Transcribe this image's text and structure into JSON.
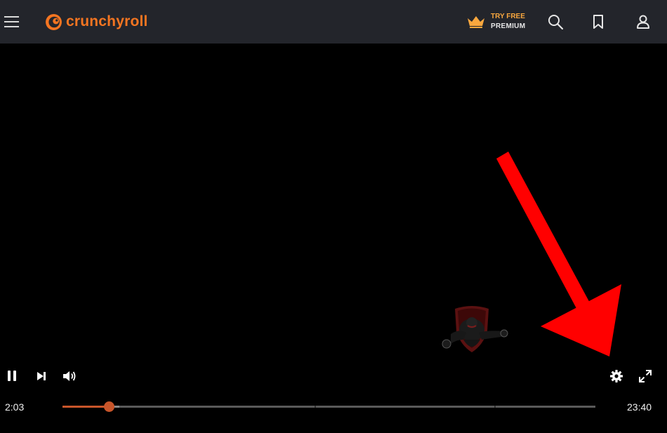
{
  "header": {
    "brand_name": "crunchyroll",
    "brand_color": "#f47521",
    "try_free_line1": "TRY FREE",
    "try_free_line2": "PREMIUM",
    "icons": [
      "menu-icon",
      "crunchyroll-logo-icon",
      "crown-icon",
      "search-icon",
      "bookmark-icon",
      "user-icon"
    ]
  },
  "player": {
    "current_time": "2:03",
    "duration": "23:40",
    "progress_fraction": 0.0866,
    "buffered_fraction": 0.107,
    "chapter_fractions": [
      0.473,
      0.81
    ],
    "accent_color": "#c8552a",
    "controls": [
      "pause-icon",
      "next-icon",
      "volume-icon",
      "settings-gear-icon",
      "fullscreen-icon"
    ]
  },
  "annotation": {
    "arrow_color": "#ff0000",
    "points_to": "settings-gear-icon"
  }
}
